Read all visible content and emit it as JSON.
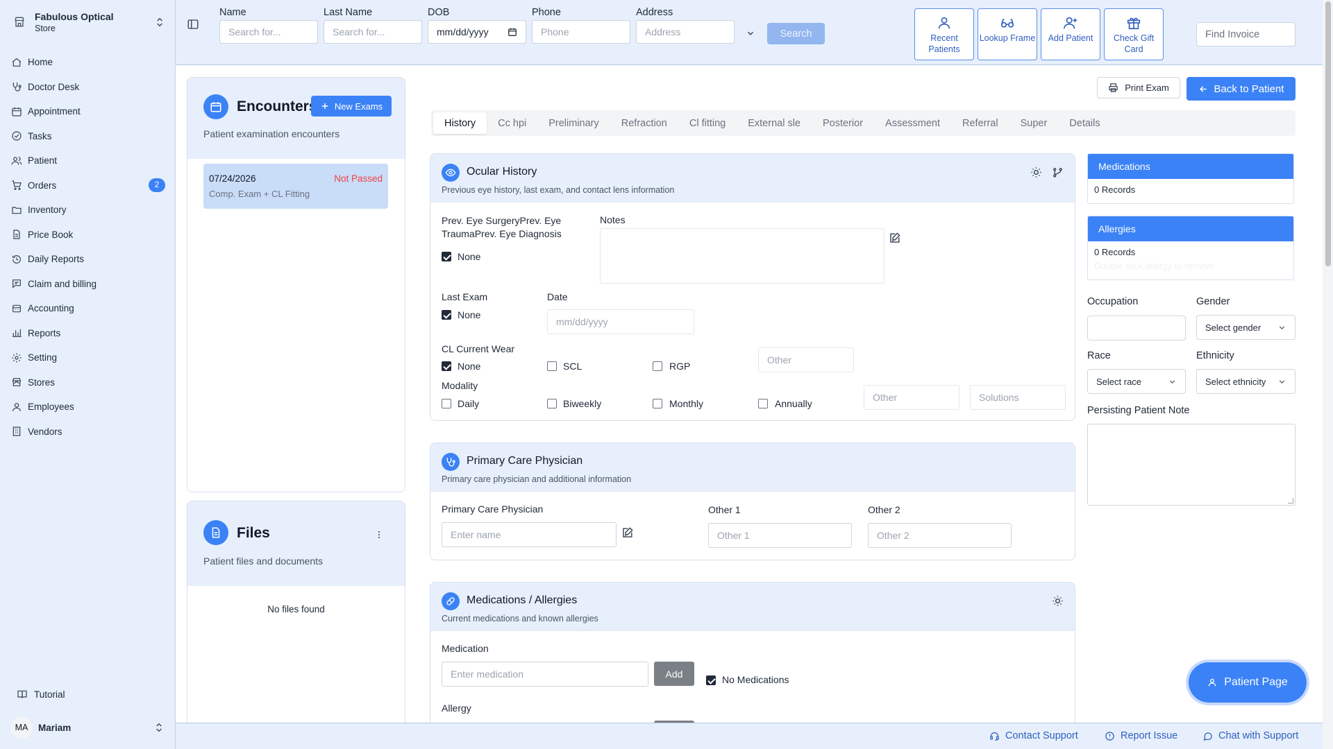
{
  "store": {
    "name": "Fabulous Optical",
    "type": "Store"
  },
  "nav": {
    "items": [
      {
        "label": "Home"
      },
      {
        "label": "Doctor Desk"
      },
      {
        "label": "Appointment"
      },
      {
        "label": "Tasks"
      },
      {
        "label": "Patient"
      },
      {
        "label": "Orders",
        "badge": "2"
      },
      {
        "label": "Inventory"
      },
      {
        "label": "Price Book"
      },
      {
        "label": "Daily Reports"
      },
      {
        "label": "Claim and billing"
      },
      {
        "label": "Accounting"
      },
      {
        "label": "Reports"
      },
      {
        "label": "Setting"
      },
      {
        "label": "Stores"
      },
      {
        "label": "Employees"
      },
      {
        "label": "Vendors"
      }
    ],
    "tutorial": "Tutorial"
  },
  "user": {
    "initials": "MA",
    "name": "Mariam"
  },
  "search": {
    "name_label": "Name",
    "name_placeholder": "Search for...",
    "last_label": "Last Name",
    "last_placeholder": "Search for...",
    "dob_label": "DOB",
    "dob_value": "mm/dd/yyyy",
    "phone_label": "Phone",
    "phone_placeholder": "Phone",
    "address_label": "Address",
    "address_placeholder": "Address",
    "button": "Search"
  },
  "quick_actions": {
    "recent": "Recent Patients",
    "lookup": "Lookup Frame",
    "add": "Add Patient",
    "gift": "Check Gift Card"
  },
  "find_invoice_placeholder": "Find Invoice",
  "encounters": {
    "title": "Encounters",
    "new_button": "New Exams",
    "subtitle": "Patient examination encounters",
    "items": [
      {
        "date": "07/24/2026",
        "status": "Not Passed",
        "desc": "Comp. Exam + CL Fitting"
      }
    ]
  },
  "files": {
    "title": "Files",
    "subtitle": "Patient files and documents",
    "empty": "No files found"
  },
  "actions": {
    "print": "Print Exam",
    "back": "Back to Patient"
  },
  "tabs": [
    "History",
    "Cc hpi",
    "Preliminary",
    "Refraction",
    "Cl fitting",
    "External sle",
    "Posterior",
    "Assessment",
    "Referral",
    "Super",
    "Details"
  ],
  "ocular": {
    "title": "Ocular History",
    "subtitle": "Previous eye history, last exam, and contact lens information",
    "prev_label": "Prev. Eye SurgeryPrev. Eye TraumaPrev. Eye Diagnosis",
    "prev_none": "None",
    "notes_label": "Notes",
    "last_exam_label": "Last Exam",
    "last_exam_none": "None",
    "date_label": "Date",
    "date_placeholder": "mm/dd/yyyy",
    "cl_label": "CL Current Wear",
    "cl_options": [
      "None",
      "SCL",
      "RGP"
    ],
    "cl_other": "Other",
    "modality_label": "Modality",
    "modality_options": [
      "Daily",
      "Biweekly",
      "Monthly",
      "Annually"
    ],
    "modality_other": "Other",
    "solutions": "Solutions"
  },
  "pcp": {
    "title": "Primary Care Physician",
    "subtitle": "Primary care physician and additional information",
    "label": "Primary Care Physician",
    "placeholder": "Enter name",
    "other1_label": "Other 1",
    "other1_placeholder": "Other 1",
    "other2_label": "Other 2",
    "other2_placeholder": "Other 2"
  },
  "medall": {
    "title": "Medications / Allergies",
    "subtitle": "Current medications and known allergies",
    "med_label": "Medication",
    "med_placeholder": "Enter medication",
    "add": "Add",
    "no_meds": "No Medications",
    "allergy_label": "Allergy"
  },
  "right": {
    "medications_title": "Medications",
    "medications_count": "0 Records",
    "allergies_title": "Allergies",
    "allergies_count": "0 Records",
    "allergies_hint": "Double click allergy to remove",
    "occupation_label": "Occupation",
    "gender_label": "Gender",
    "gender_select": "Select gender",
    "race_label": "Race",
    "race_select": "Select race",
    "ethnicity_label": "Ethnicity",
    "ethnicity_select": "Select ethnicity",
    "note_label": "Persisting Patient Note"
  },
  "footer": {
    "contact": "Contact Support",
    "report": "Report Issue",
    "chat": "Chat with Support"
  },
  "patient_page": "Patient Page",
  "colors": {
    "accent": "#3b82f6",
    "panel": "#e6effb",
    "danger": "#ef4444"
  }
}
